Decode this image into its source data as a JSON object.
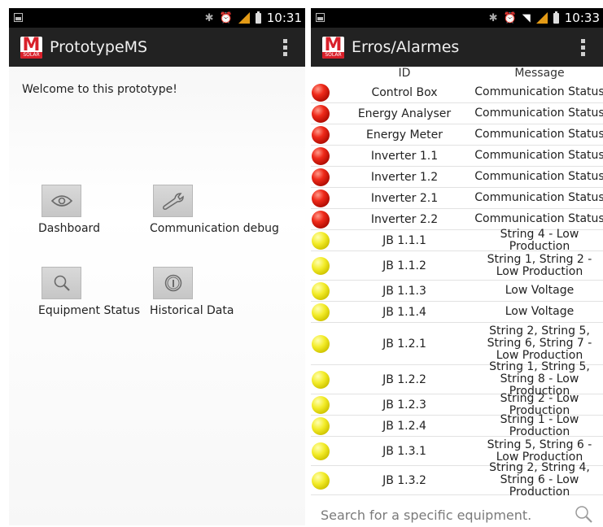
{
  "left": {
    "statusbar": {
      "time": "10:31"
    },
    "actionbar": {
      "logo_letter": "M",
      "logo_sub": "SOLAR",
      "title": "PrototypeMS"
    },
    "welcome": "Welcome to this prototype!",
    "tiles": [
      {
        "label": "Dashboard",
        "icon": "eye-icon"
      },
      {
        "label": "Communication debug",
        "icon": "wrench-icon"
      },
      {
        "label": "Equipment Status",
        "icon": "magnifier-icon"
      },
      {
        "label": "Historical Data",
        "icon": "info-icon"
      }
    ]
  },
  "right": {
    "statusbar": {
      "time": "10:33"
    },
    "actionbar": {
      "logo_letter": "M",
      "logo_sub": "SOLAR",
      "title": "Erros/Alarmes"
    },
    "table": {
      "columns": [
        "ID",
        "Message"
      ],
      "rows": [
        {
          "status": "red",
          "id": "Control Box",
          "message": "Communication Status"
        },
        {
          "status": "red",
          "id": "Energy Analyser",
          "message": "Communication Status"
        },
        {
          "status": "red",
          "id": "Energy Meter",
          "message": "Communication Status"
        },
        {
          "status": "red",
          "id": "Inverter 1.1",
          "message": "Communication Status"
        },
        {
          "status": "red",
          "id": "Inverter 1.2",
          "message": "Communication Status"
        },
        {
          "status": "red",
          "id": "Inverter 2.1",
          "message": "Communication Status"
        },
        {
          "status": "red",
          "id": "Inverter 2.2",
          "message": "Communication Status"
        },
        {
          "status": "yellow",
          "id": "JB 1.1.1",
          "message": "String 4 - Low Production"
        },
        {
          "status": "yellow",
          "id": "JB 1.1.2",
          "message": "String 1, String 2 - Low Production"
        },
        {
          "status": "yellow",
          "id": "JB 1.1.3",
          "message": "Low Voltage"
        },
        {
          "status": "yellow",
          "id": "JB 1.1.4",
          "message": "Low Voltage"
        },
        {
          "status": "yellow",
          "id": "JB 1.2.1",
          "message": "String 2, String 5, String 6, String 7 - Low Production"
        },
        {
          "status": "yellow",
          "id": "JB 1.2.2",
          "message": "String 1, String 5, String 8 - Low Production"
        },
        {
          "status": "yellow",
          "id": "JB 1.2.3",
          "message": "String 2 - Low Production"
        },
        {
          "status": "yellow",
          "id": "JB 1.2.4",
          "message": "String 1 - Low Production"
        },
        {
          "status": "yellow",
          "id": "JB 1.3.1",
          "message": "String 5, String 6 - Low Production"
        },
        {
          "status": "yellow",
          "id": "JB 1.3.2",
          "message": "String 2, String 4, String 6 - Low Production"
        }
      ]
    },
    "search": {
      "placeholder": "Search for a specific equipment."
    }
  },
  "colors": {
    "actionbar": "#222222",
    "statusbar": "#000000",
    "brand_red": "#d8202a",
    "alarm_red": "#ef2a1a",
    "warning_yellow": "#f3ec2a"
  }
}
